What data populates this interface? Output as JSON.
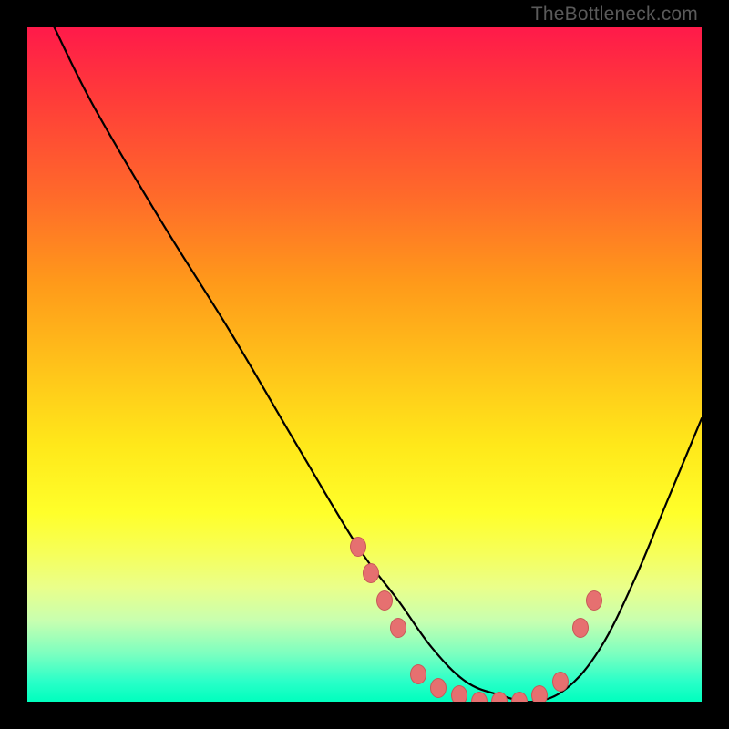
{
  "attribution": "TheBottleneck.com",
  "chart_data": {
    "type": "line",
    "title": "",
    "xlabel": "",
    "ylabel": "",
    "xlim": [
      0,
      100
    ],
    "ylim": [
      0,
      100
    ],
    "grid": false,
    "legend": false,
    "background_gradient": {
      "top": "#ff1a4a",
      "bottom": "#00ffbe",
      "meaning": "red=high bottleneck, green=low bottleneck"
    },
    "series": [
      {
        "name": "bottleneck-curve",
        "color": "#000000",
        "x": [
          4,
          10,
          20,
          30,
          40,
          49,
          55,
          60,
          65,
          70,
          75,
          80,
          85,
          90,
          95,
          100
        ],
        "y": [
          100,
          88,
          71,
          55,
          38,
          23,
          15,
          8,
          3,
          1,
          0,
          2,
          8,
          18,
          30,
          42
        ]
      }
    ],
    "points": [
      {
        "name": "p1",
        "x": 49,
        "y": 23
      },
      {
        "name": "p2",
        "x": 51,
        "y": 19
      },
      {
        "name": "p3",
        "x": 53,
        "y": 15
      },
      {
        "name": "p4",
        "x": 55,
        "y": 11
      },
      {
        "name": "p5",
        "x": 58,
        "y": 4
      },
      {
        "name": "p6",
        "x": 61,
        "y": 2
      },
      {
        "name": "p7",
        "x": 64,
        "y": 1
      },
      {
        "name": "p8",
        "x": 67,
        "y": 0
      },
      {
        "name": "p9",
        "x": 70,
        "y": 0
      },
      {
        "name": "p10",
        "x": 73,
        "y": 0
      },
      {
        "name": "p11",
        "x": 76,
        "y": 1
      },
      {
        "name": "p12",
        "x": 79,
        "y": 3
      },
      {
        "name": "p13",
        "x": 82,
        "y": 11
      },
      {
        "name": "p14",
        "x": 84,
        "y": 15
      }
    ],
    "point_color": "#e67070"
  }
}
